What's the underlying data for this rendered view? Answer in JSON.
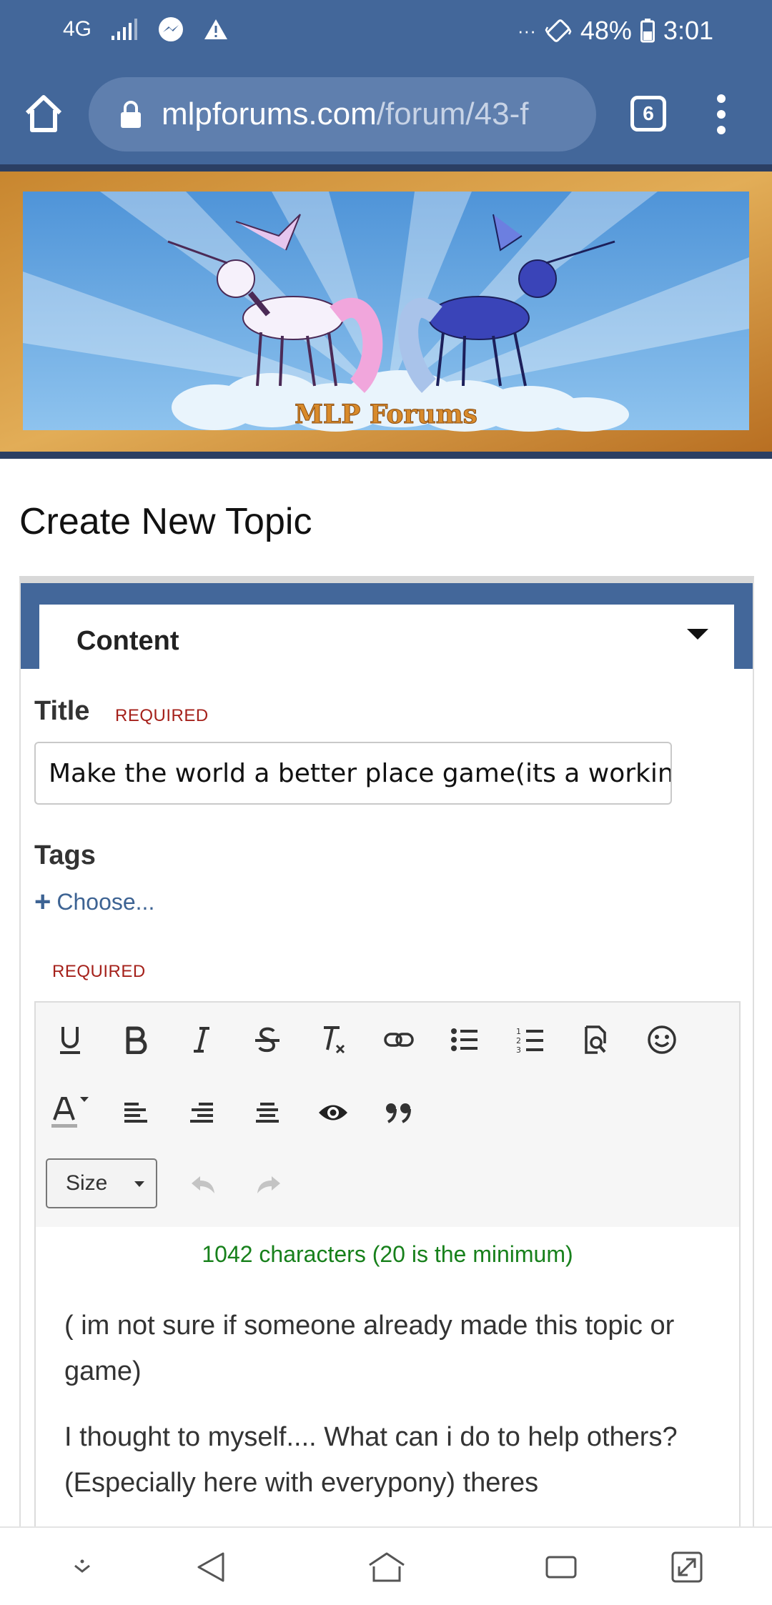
{
  "status_bar": {
    "network": "4G",
    "more": "···",
    "battery": "48%",
    "time": "3:01"
  },
  "browser": {
    "url_domain": "mlpforums.com",
    "url_path": "/forum/43-f",
    "tab_count": "6"
  },
  "banner": {
    "logo_text": "MLP Forums"
  },
  "page": {
    "title": "Create New Topic"
  },
  "content_section": {
    "label": "Content"
  },
  "form": {
    "title_label": "Title",
    "required": "REQUIRED",
    "title_value": "Make the world a better place game(its a workin",
    "tags_label": "Tags",
    "choose_label": "Choose...",
    "body_required": "REQUIRED"
  },
  "editor": {
    "size_label": "Size",
    "char_count": "1042 characters (20 is the minimum)",
    "paragraphs": [
      "( im not sure if someone already made this topic or game)",
      "I thought to myself.... What can i do to help others? (Especially here with everypony) theres"
    ]
  },
  "colors": {
    "brand_blue": "#43679a",
    "required_red": "#a5211b",
    "count_green": "#17801b",
    "link_blue": "#3d6393"
  }
}
